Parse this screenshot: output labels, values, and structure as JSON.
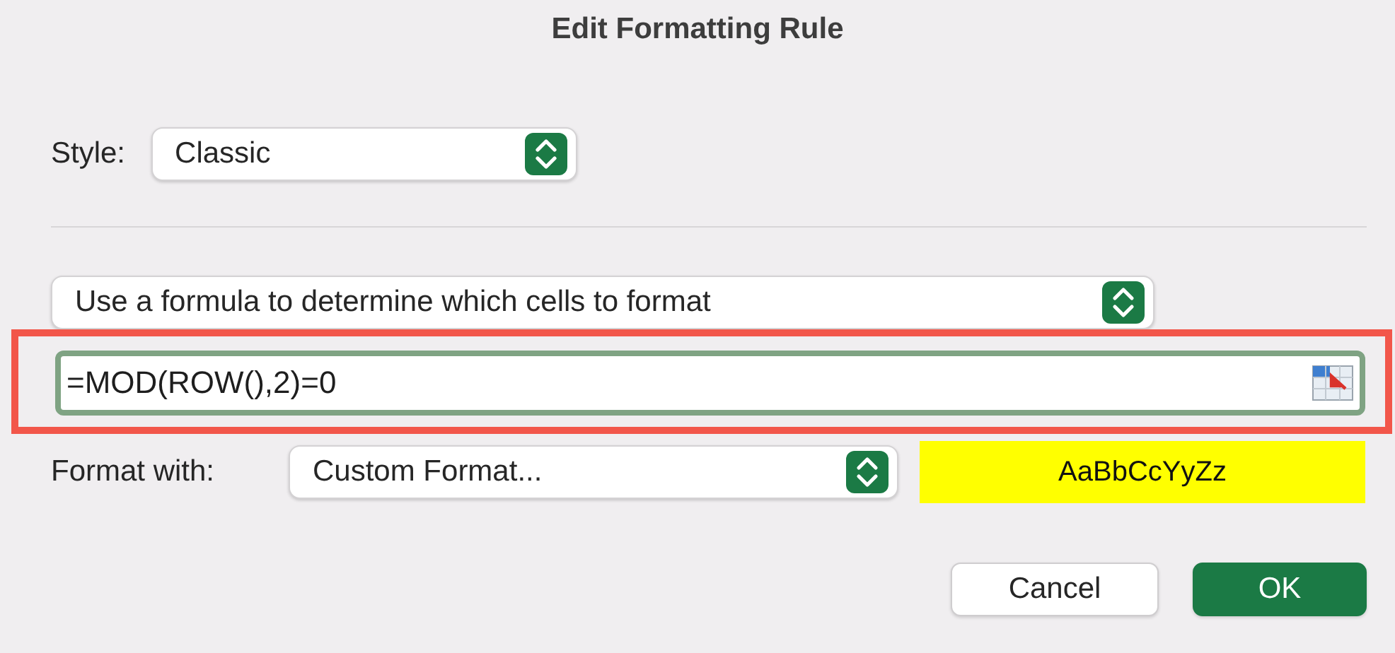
{
  "window": {
    "title": "Edit Formatting Rule"
  },
  "style": {
    "label": "Style:",
    "value": "Classic"
  },
  "rule_type": {
    "value": "Use a formula to determine which cells to format"
  },
  "formula": {
    "value": "=MOD(ROW(),2)=0",
    "highlighted": true
  },
  "format_with": {
    "label": "Format with:",
    "value": "Custom Format...",
    "preview": "AaBbCcYyZz"
  },
  "buttons": [
    {
      "label": "Cancel",
      "default": false
    },
    {
      "label": "OK",
      "default": true
    }
  ]
}
